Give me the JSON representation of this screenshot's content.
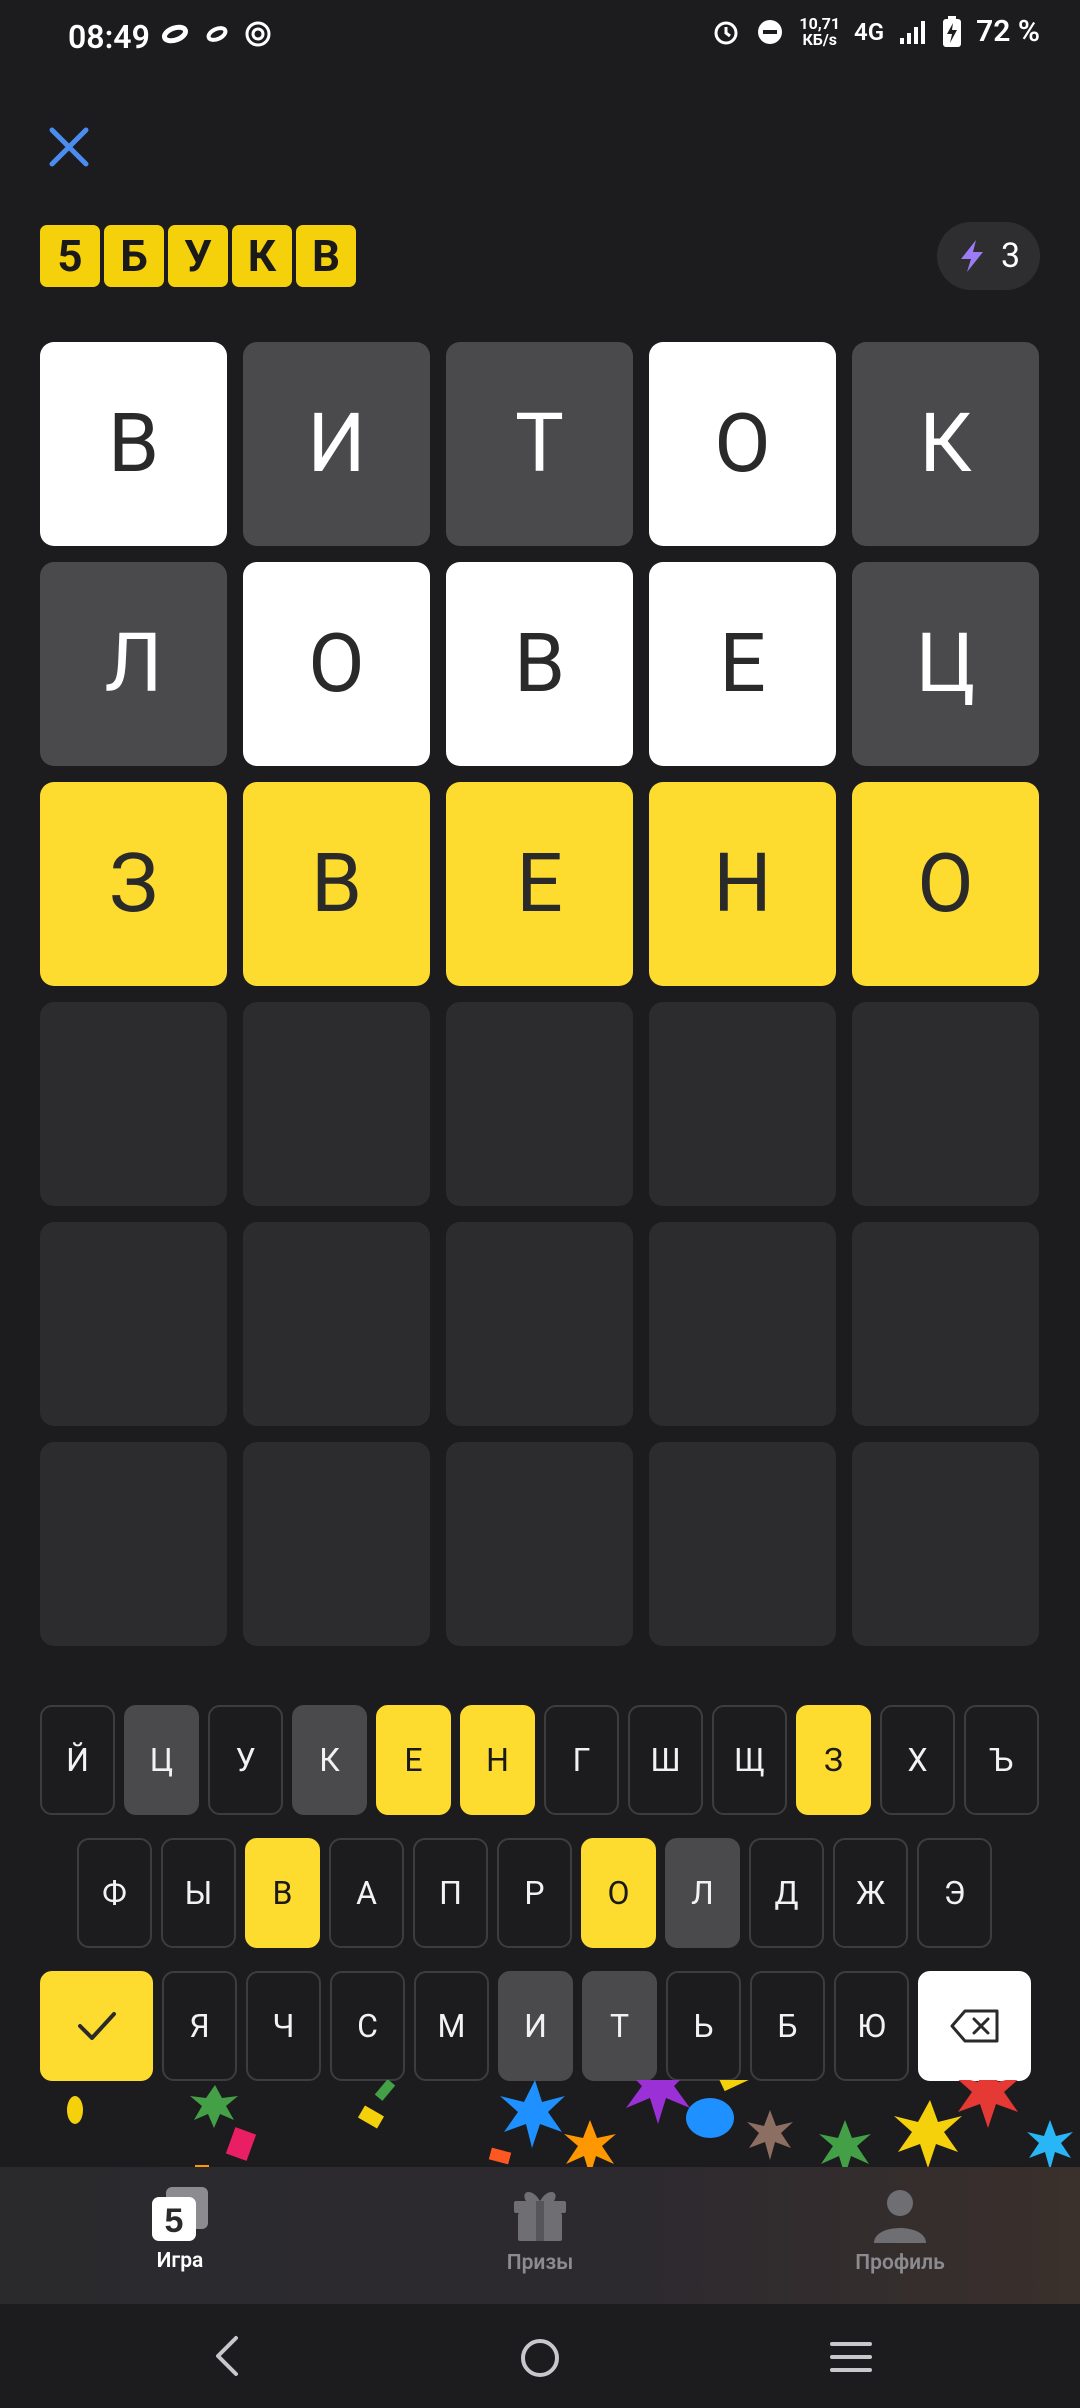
{
  "status_bar": {
    "time": "08:49",
    "net_speed_value": "10,71",
    "net_speed_unit": "КБ/s",
    "network": "4G",
    "battery": "72 %"
  },
  "logo": [
    "5",
    "Б",
    "У",
    "К",
    "В"
  ],
  "hints": {
    "count": "3"
  },
  "board": {
    "rows": [
      [
        {
          "l": "В",
          "s": "present"
        },
        {
          "l": "И",
          "s": "absent"
        },
        {
          "l": "Т",
          "s": "absent"
        },
        {
          "l": "О",
          "s": "present"
        },
        {
          "l": "К",
          "s": "absent"
        }
      ],
      [
        {
          "l": "Л",
          "s": "absent"
        },
        {
          "l": "О",
          "s": "present"
        },
        {
          "l": "В",
          "s": "present"
        },
        {
          "l": "Е",
          "s": "present"
        },
        {
          "l": "Ц",
          "s": "absent"
        }
      ],
      [
        {
          "l": "З",
          "s": "correct"
        },
        {
          "l": "В",
          "s": "correct"
        },
        {
          "l": "Е",
          "s": "correct"
        },
        {
          "l": "Н",
          "s": "correct"
        },
        {
          "l": "О",
          "s": "correct"
        }
      ]
    ]
  },
  "keyboard": {
    "row1": [
      {
        "k": "Й",
        "s": ""
      },
      {
        "k": "Ц",
        "s": "absent"
      },
      {
        "k": "У",
        "s": ""
      },
      {
        "k": "К",
        "s": "absent"
      },
      {
        "k": "Е",
        "s": "correct"
      },
      {
        "k": "Н",
        "s": "correct"
      },
      {
        "k": "Г",
        "s": ""
      },
      {
        "k": "Ш",
        "s": ""
      },
      {
        "k": "Щ",
        "s": ""
      },
      {
        "k": "З",
        "s": "correct"
      },
      {
        "k": "Х",
        "s": ""
      },
      {
        "k": "Ъ",
        "s": ""
      }
    ],
    "row2": [
      {
        "k": "Ф",
        "s": ""
      },
      {
        "k": "Ы",
        "s": ""
      },
      {
        "k": "В",
        "s": "correct"
      },
      {
        "k": "А",
        "s": ""
      },
      {
        "k": "П",
        "s": ""
      },
      {
        "k": "Р",
        "s": ""
      },
      {
        "k": "О",
        "s": "correct"
      },
      {
        "k": "Л",
        "s": "absent"
      },
      {
        "k": "Д",
        "s": ""
      },
      {
        "k": "Ж",
        "s": ""
      },
      {
        "k": "Э",
        "s": ""
      }
    ],
    "row3": [
      {
        "k": "Я",
        "s": ""
      },
      {
        "k": "Ч",
        "s": ""
      },
      {
        "k": "С",
        "s": ""
      },
      {
        "k": "М",
        "s": ""
      },
      {
        "k": "И",
        "s": "absent"
      },
      {
        "k": "Т",
        "s": "absent"
      },
      {
        "k": "Ь",
        "s": ""
      },
      {
        "k": "Б",
        "s": ""
      },
      {
        "k": "Ю",
        "s": ""
      }
    ]
  },
  "bottom_nav": {
    "game_label": "Игра",
    "prizes_label": "Призы",
    "profile_label": "Профиль",
    "game_icon_glyph": "5"
  },
  "colors": {
    "correct": "#fddc2f",
    "absent": "#4a4a4c",
    "present": "#ffffff",
    "accent_close": "#4a8cf0"
  }
}
